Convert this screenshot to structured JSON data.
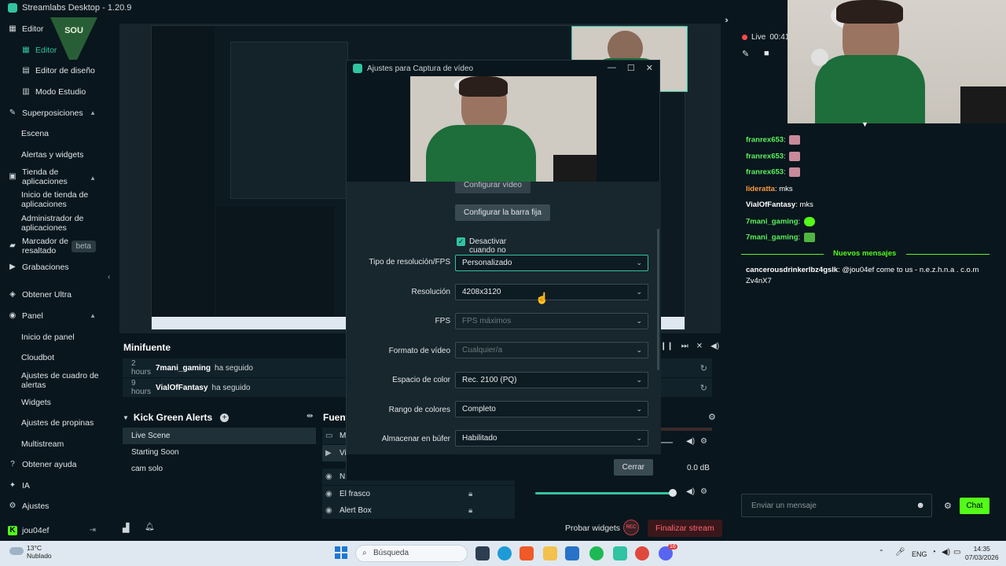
{
  "window": {
    "title": "Streamlabs Desktop - 1.20.9"
  },
  "sidebar": {
    "items": [
      {
        "label": "Editor",
        "icon": "layout-icon"
      },
      {
        "label": "Editor",
        "sub": true,
        "active": true
      },
      {
        "label": "Editor de diseño",
        "sub": true
      },
      {
        "label": "Modo Estudio",
        "sub": true
      },
      {
        "label": "Superposiciones",
        "icon": "brush-icon"
      },
      {
        "label": "Escena",
        "sub": true
      },
      {
        "label": "Alertas y widgets",
        "sub": true
      },
      {
        "label": "Tienda de aplicaciones",
        "icon": "store-icon"
      },
      {
        "label": "Inicio de tienda de aplicaciones",
        "sub": true
      },
      {
        "label": "Administrador de aplicaciones",
        "sub": true
      },
      {
        "label": "Marcador de resaltado",
        "icon": "highlight-icon",
        "badge": "beta"
      },
      {
        "label": "Grabaciones",
        "icon": "play-icon"
      },
      {
        "label": "Obtener Ultra",
        "icon": "ultra-icon"
      },
      {
        "label": "Panel",
        "icon": "panel-icon"
      },
      {
        "label": "Inicio de panel",
        "sub": true
      },
      {
        "label": "Cloudbot",
        "sub": true
      },
      {
        "label": "Ajustes de cuadro de alertas",
        "sub": true
      },
      {
        "label": "Widgets",
        "sub": true
      },
      {
        "label": "Ajustes de propinas",
        "sub": true
      },
      {
        "label": "Multistream",
        "sub": true
      },
      {
        "label": "Obtener ayuda",
        "icon": "help-icon"
      },
      {
        "label": "IA",
        "icon": "ai-icon"
      },
      {
        "label": "Ajustes",
        "icon": "gear-icon"
      }
    ],
    "user": "jou04ef",
    "badge_beta": "beta"
  },
  "minifuente": {
    "title": "Minifuente",
    "events": [
      {
        "ago": "2 hours",
        "name": "7mani_gaming",
        "action": "ha seguido"
      },
      {
        "ago": "9 hours",
        "name": "VialOfFantasy",
        "action": "ha seguido"
      }
    ]
  },
  "scenes": {
    "title": "Kick Green Alerts",
    "items": [
      "Live Scene",
      "Starting Soon",
      "cam solo"
    ]
  },
  "sources": {
    "title": "Fuente",
    "items": [
      "M",
      "Vi",
      "N",
      "El frasco",
      "Alert Box"
    ]
  },
  "mixer": {
    "db": "0.0 dB"
  },
  "bottombar": {
    "test_widgets": "Probar widgets",
    "rec": "REC",
    "end_stream": "Finalizar stream"
  },
  "live": {
    "label": "Live",
    "time": "00:41"
  },
  "chat": {
    "messages": [
      {
        "user": "franrex653",
        "text": "",
        "color": "#5cf25c",
        "emote": "#c98a9a"
      },
      {
        "user": "franrex653",
        "text": "",
        "color": "#5cf25c",
        "emote": "#c98a9a"
      },
      {
        "user": "franrex653",
        "text": "",
        "color": "#5cf25c",
        "emote": "#c98a9a"
      },
      {
        "user": "lideratta",
        "text": "mks",
        "color": "#ff9c3f"
      },
      {
        "user": "VialOfFantasy",
        "text": "mks",
        "color": "#ffffff"
      },
      {
        "user": "7mani_gaming",
        "text": "",
        "color": "#5cf25c",
        "emote": "#53fc18"
      },
      {
        "user": "7mani_gaming",
        "text": "",
        "color": "#5cf25c",
        "emote": "#4fb53f"
      }
    ],
    "new_messages_label": "Nuevos mensajes",
    "spam": {
      "user": "cancerousdrinkerlbz4gslk",
      "text": "@jou04ef come to us - n.e.z.h.n.a . c.o.m",
      "line2": "Zv4nX7"
    },
    "input_placeholder": "Enviar un mensaje",
    "send_label": "Chat",
    "brand_color": "#53fc18"
  },
  "dialog": {
    "title": "Ajustes para Captura de vídeo",
    "configure_video_label": "Configurar vídeo",
    "configure_crossbar_label": "Configurar la barra fija",
    "deactivate_label": "Desactivar cuando no se muestre",
    "deactivate_checked": true,
    "fields": [
      {
        "label": "Tipo de resolución/FPS",
        "value": "Personalizado",
        "focused": true
      },
      {
        "label": "Resolución",
        "value": "4208x3120"
      },
      {
        "label": "FPS",
        "value": "FPS máximos",
        "disabled": true
      },
      {
        "label": "Formato de vídeo",
        "value": "Cualquier/a",
        "disabled": true
      },
      {
        "label": "Espacio de color",
        "value": "Rec. 2100 (PQ)"
      },
      {
        "label": "Rango de colores",
        "value": "Completo"
      },
      {
        "label": "Almacenar en búfer",
        "value": "Habilitado"
      }
    ],
    "close_label": "Cerrar"
  },
  "taskbar": {
    "weather_temp": "13°C",
    "weather_desc": "Nublado",
    "search_placeholder": "Búsqueda",
    "lang": "ENG",
    "time": "14:35",
    "date": "07/03/2026",
    "discord_badge": "16"
  }
}
